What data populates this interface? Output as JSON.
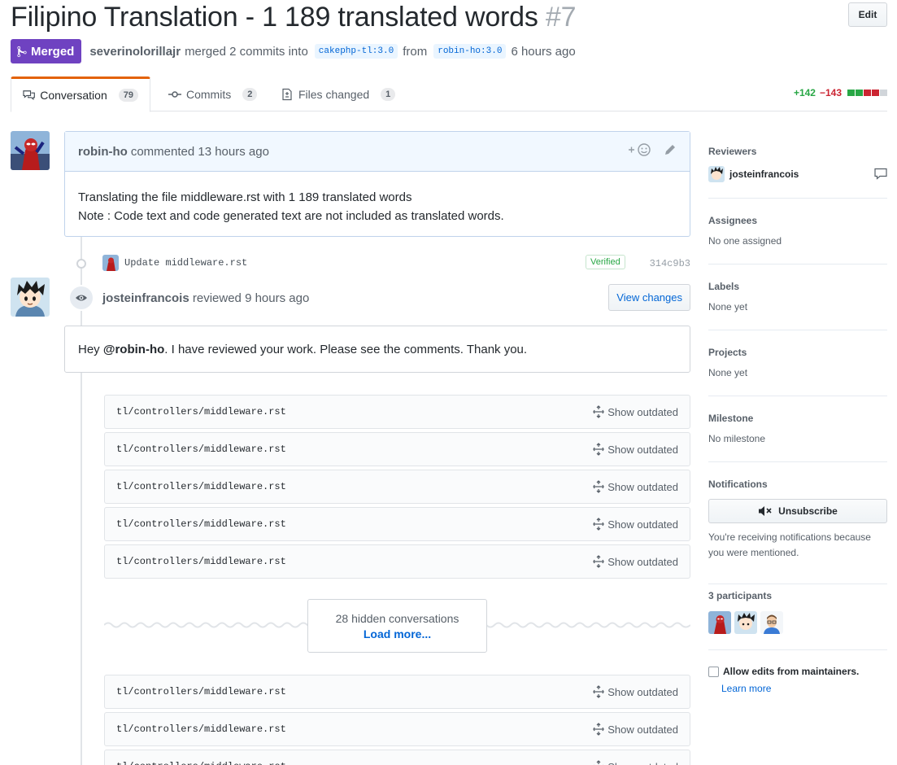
{
  "header": {
    "title": "Filipino Translation - 1 189 translated words",
    "number": "#7",
    "edit_label": "Edit"
  },
  "meta": {
    "state": "Merged",
    "author": "severinolorillajr",
    "action": "merged 2 commits into",
    "base_branch": "cakephp-tl:3.0",
    "from_word": "from",
    "head_branch": "robin-ho:3.0",
    "time": "6 hours ago"
  },
  "tabs": [
    {
      "label": "Conversation",
      "count": "79"
    },
    {
      "label": "Commits",
      "count": "2"
    },
    {
      "label": "Files changed",
      "count": "1"
    }
  ],
  "diffstat": {
    "additions": "+142",
    "deletions": "−143"
  },
  "comment": {
    "author": "robin-ho",
    "action": "commented 13 hours ago",
    "line1": "Translating the file middleware.rst with 1 189 translated words",
    "line2": "Note : Code text and code generated text are not included as translated words."
  },
  "commit": {
    "message": "Update middleware.rst",
    "verified": "Verified",
    "sha": "314c9b3"
  },
  "review": {
    "author": "josteinfrancois",
    "action": "reviewed 9 hours ago",
    "view_changes": "View changes",
    "body_pre": "Hey ",
    "mention": "@robin-ho",
    "body_post": ". I have reviewed your work. Please see the comments. Thank you."
  },
  "files": {
    "path": "tl/controllers/middleware.rst",
    "show_outdated": "Show outdated"
  },
  "hidden": {
    "count_text": "28 hidden conversations",
    "load_more": "Load more..."
  },
  "sidebar": {
    "reviewers_h": "Reviewers",
    "reviewer": "josteinfrancois",
    "assignees_h": "Assignees",
    "assignees_v": "No one assigned",
    "labels_h": "Labels",
    "labels_v": "None yet",
    "projects_h": "Projects",
    "projects_v": "None yet",
    "milestone_h": "Milestone",
    "milestone_v": "No milestone",
    "notifications_h": "Notifications",
    "unsubscribe": "Unsubscribe",
    "notif_text": "You're receiving notifications because you were mentioned.",
    "participants_h": "3 participants",
    "allow_edits": "Allow edits from maintainers.",
    "learn_more": "Learn more"
  },
  "colors": {
    "merged": "#6f42c1",
    "link": "#0366d6",
    "add": "#28a745",
    "del": "#cb2431"
  }
}
